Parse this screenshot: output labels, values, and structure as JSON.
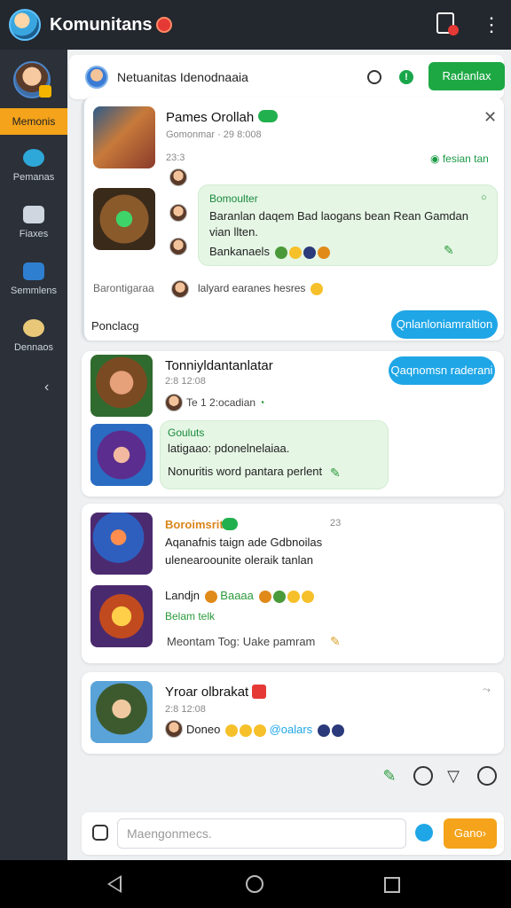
{
  "app": {
    "title": "Komunitans"
  },
  "sidebar": {
    "items": [
      {
        "label": "Memonis",
        "icon": "home-icon",
        "active": true
      },
      {
        "label": "Pemanas",
        "icon": "chat-icon"
      },
      {
        "label": "Fiaxes",
        "icon": "friends-icon"
      },
      {
        "label": "Semmlens",
        "icon": "folder-icon"
      },
      {
        "label": "Dennaos",
        "icon": "trophy-icon"
      }
    ]
  },
  "header": {
    "title": "Netuanitas Idenodnaaia",
    "button_label": "Radanlax"
  },
  "cards": [
    {
      "name": "Pames Orollah",
      "meta": "Gomonmar · 29 8:008",
      "date_row": "23:3",
      "link": "fesian tan",
      "bubble_title": "Bomoulter",
      "bubble_text_1": "Baranlan daqem Bad laogans bean Rean Gamdan",
      "bubble_text_2": "vian llten.",
      "bubble_footer": "Bankanaels",
      "comment_name": "Barontigaraa",
      "comment_text": "lalyard earanes hesres",
      "footer_label": "Ponclacg",
      "footer_button": "Qnlanloniamraltion"
    },
    {
      "name": "Tonniyldantanlatar",
      "meta": "2:8 12:08",
      "user_line": "Te 1 2:ocadian",
      "pill": "Qaqnomsn raderani",
      "bubble_title": "Gouluts",
      "bubble_text": "latigaao: pdonelnelaiaa.",
      "bubble_footer": "Nonuritis word pantara perlent"
    },
    {
      "name": "Boroimsrit",
      "meta_right": "23",
      "line1": "Aqanafnis taign ade Gdbnoilas",
      "line2": "ulenearoounite oleraik tanlan",
      "line3": "Landjn",
      "line3_tag": "Baaaa",
      "line4": "Belam telk",
      "line5": "Meontam Tog: Uake pamram"
    },
    {
      "name": "Yroar olbrakat",
      "meta": "2:8 12:08",
      "user_line": "Doneo",
      "mention": "@oalars"
    }
  ],
  "composer": {
    "placeholder": "Maengonmecs.",
    "send_label": "Gano"
  },
  "colors": {
    "accent_orange": "#f4a31a",
    "accent_green": "#1da844",
    "accent_blue": "#1fa6e6",
    "sidebar_bg": "#2b3039"
  }
}
